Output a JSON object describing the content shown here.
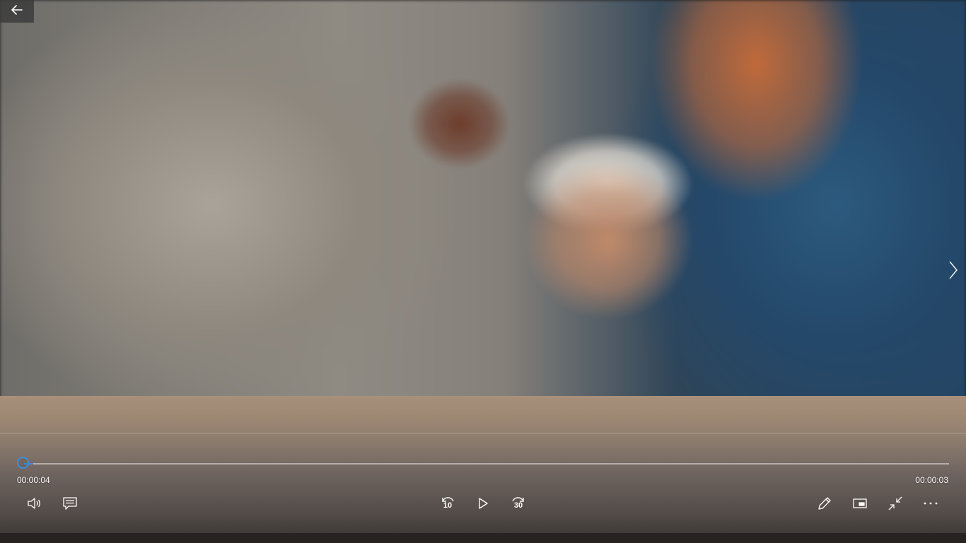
{
  "player": {
    "elapsed_time": "00:00:04",
    "remaining_time": "00:00:03",
    "progress": 0.01,
    "skip_back_seconds": "10",
    "skip_forward_seconds": "30",
    "accent_color": "#3b8ee0"
  },
  "icons": {
    "back": "arrow-left-icon",
    "next": "chevron-right-icon",
    "volume": "volume-icon",
    "subtitles": "subtitles-icon",
    "skip_back": "skip-back-10-icon",
    "play": "play-icon",
    "skip_forward": "skip-forward-30-icon",
    "edit": "pencil-icon",
    "mini_view": "mini-view-icon",
    "exit_fullscreen": "exit-fullscreen-icon",
    "more": "more-options-icon"
  }
}
